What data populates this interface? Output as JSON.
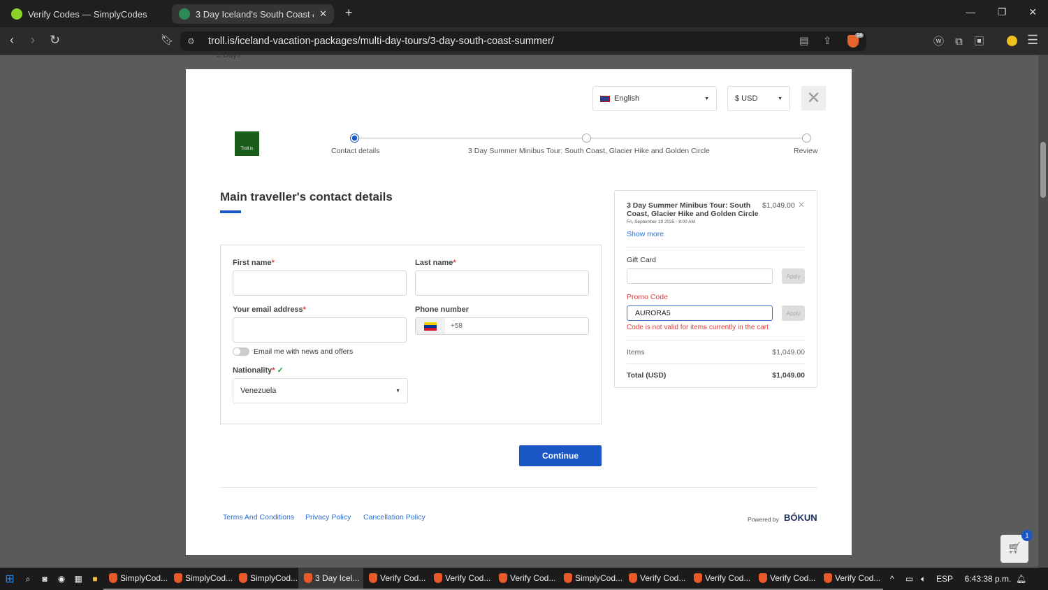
{
  "browser": {
    "tabs": [
      {
        "title": "Verify Codes — SimplyCodes"
      },
      {
        "title": "3 Day Iceland's South Coast & G"
      }
    ],
    "url": "troll.is/iceland-vacation-packages/multi-day-tours/3-day-south-coast-summer/",
    "shields_count": "14",
    "behind_text": "3 Days"
  },
  "modal": {
    "language": "English",
    "currency": "$ USD",
    "logo_text": "Troll.is",
    "steps": [
      {
        "label": "Contact details",
        "active": true
      },
      {
        "label": "3 Day Summer Minibus Tour: South Coast, Glacier Hike and Golden Circle",
        "active": false
      },
      {
        "label": "Review",
        "active": false
      }
    ],
    "heading": "Main traveller's contact details",
    "form": {
      "first_name_label": "First name",
      "last_name_label": "Last name",
      "email_label": "Your email address",
      "phone_label": "Phone number",
      "phone_prefix": "+58",
      "required_mark": "*",
      "newsletter_label": "Email me with news and offers",
      "nationality_label": "Nationality",
      "nationality_value": "Venezuela"
    },
    "continue_label": "Continue",
    "cart": {
      "item_title": "3 Day Summer Minibus Tour: South Coast, Glacier Hike and Golden Circle",
      "item_price": "$1,049.00",
      "item_date": "Fri, September 19 2025 - 8:00 AM",
      "show_more": "Show more",
      "gift_card_label": "Gift Card",
      "apply_label": "Apply",
      "promo_label": "Promo Code",
      "promo_value": "AURORA5",
      "promo_error": "Code is not valid for items currently in the cart",
      "items_label": "Items",
      "items_value": "$1,049.00",
      "total_label": "Total (USD)",
      "total_value": "$1,049.00"
    },
    "footer": {
      "links": [
        "Terms And Conditions",
        "Privacy Policy",
        "Cancellation Policy"
      ],
      "powered_by": "Powered by",
      "brand": "BÓKUN"
    }
  },
  "cart_badge": "1",
  "taskbar": {
    "items": [
      "SimplyCod...",
      "SimplyCod...",
      "SimplyCod...",
      "3 Day Icel...",
      "Verify Cod...",
      "Verify Cod...",
      "Verify Cod...",
      "SimplyCod...",
      "Verify Cod...",
      "Verify Cod...",
      "Verify Cod...",
      "Verify Cod..."
    ],
    "lang": "ESP",
    "time": "6:43:38 p.m."
  }
}
